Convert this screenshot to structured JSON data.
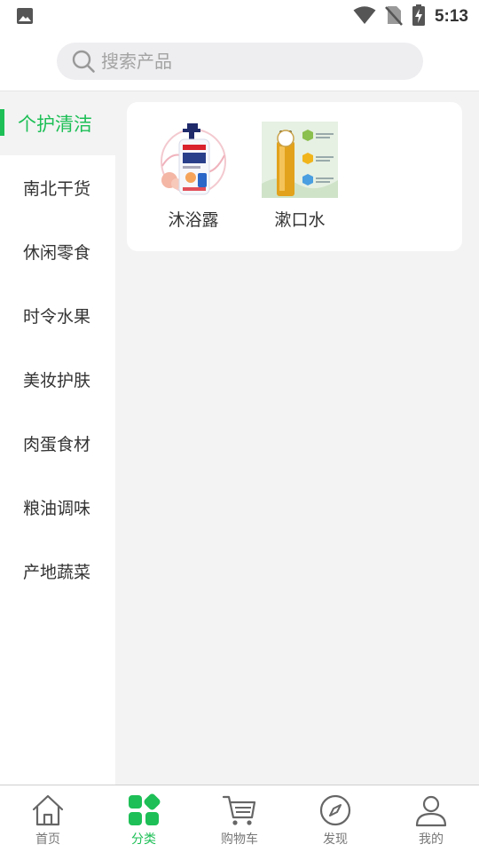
{
  "status_bar": {
    "time": "5:13"
  },
  "search": {
    "placeholder": "搜索产品"
  },
  "colors": {
    "accent": "#1dbf56",
    "tab_inactive": "#777777"
  },
  "sidebar": {
    "items": [
      {
        "label": "个护清洁",
        "active": true
      },
      {
        "label": "南北干货"
      },
      {
        "label": "休闲零食"
      },
      {
        "label": "时令水果"
      },
      {
        "label": "美妆护肤"
      },
      {
        "label": "肉蛋食材"
      },
      {
        "label": "粮油调味"
      },
      {
        "label": "产地蔬菜"
      }
    ]
  },
  "products": [
    {
      "name": "沐浴露",
      "icon": "body-wash-bottle-image"
    },
    {
      "name": "漱口水",
      "icon": "mouthwash-bottle-image"
    }
  ],
  "tabbar": {
    "items": [
      {
        "label": "首页",
        "icon": "home-icon"
      },
      {
        "label": "分类",
        "icon": "category-grid-icon",
        "active": true
      },
      {
        "label": "购物车",
        "icon": "cart-icon"
      },
      {
        "label": "发现",
        "icon": "compass-icon"
      },
      {
        "label": "我的",
        "icon": "user-icon"
      }
    ]
  }
}
